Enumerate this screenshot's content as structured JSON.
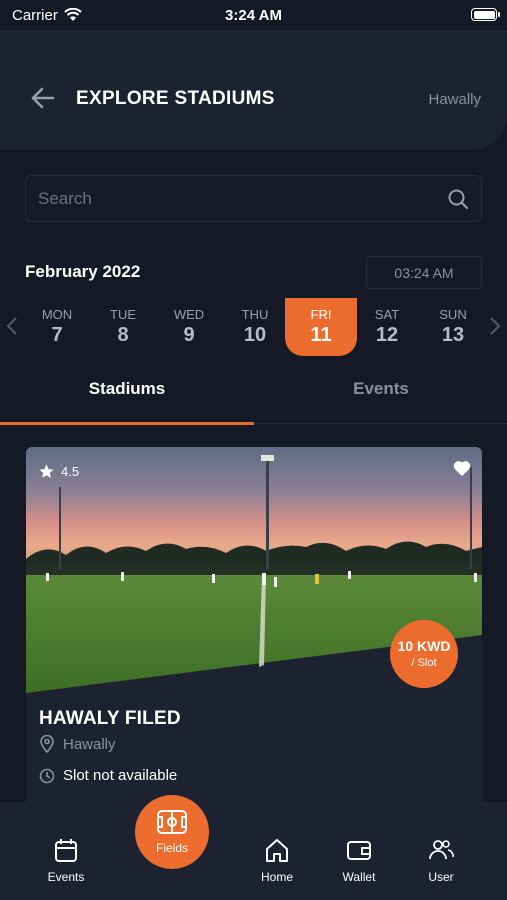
{
  "status_bar": {
    "carrier": "Carrier",
    "time": "3:24 AM"
  },
  "header": {
    "title": "EXPLORE STADIUMS",
    "location": "Hawally"
  },
  "search": {
    "placeholder": "Search"
  },
  "calendar": {
    "month": "February 2022",
    "time": "03:24 AM",
    "days": [
      {
        "name": "MON",
        "date": "7"
      },
      {
        "name": "TUE",
        "date": "8"
      },
      {
        "name": "WED",
        "date": "9"
      },
      {
        "name": "THU",
        "date": "10"
      },
      {
        "name": "FRI",
        "date": "11"
      },
      {
        "name": "SAT",
        "date": "12"
      },
      {
        "name": "SUN",
        "date": "13"
      }
    ],
    "selected_day": "FRI"
  },
  "tabs": [
    {
      "label": "Stadiums",
      "active": true
    },
    {
      "label": "Events",
      "active": false
    }
  ],
  "stadium_card": {
    "rating": "4.5",
    "price": "10 KWD",
    "price_unit": "/ Slot",
    "name": "HAWALY FILED",
    "location": "Hawally",
    "slot_status": "Slot not available"
  },
  "bottom_nav": {
    "items": [
      {
        "label": "Events",
        "icon": "calendar-icon"
      },
      {
        "label": "Fields",
        "icon": "field-icon"
      },
      {
        "label": "Home",
        "icon": "home-icon"
      },
      {
        "label": "Wallet",
        "icon": "wallet-icon"
      },
      {
        "label": "User",
        "icon": "users-icon"
      }
    ],
    "active": "Fields"
  },
  "colors": {
    "accent": "#ec6c2e",
    "background": "#141925",
    "surface": "#1c2230",
    "muted_text": "#8a909c"
  }
}
